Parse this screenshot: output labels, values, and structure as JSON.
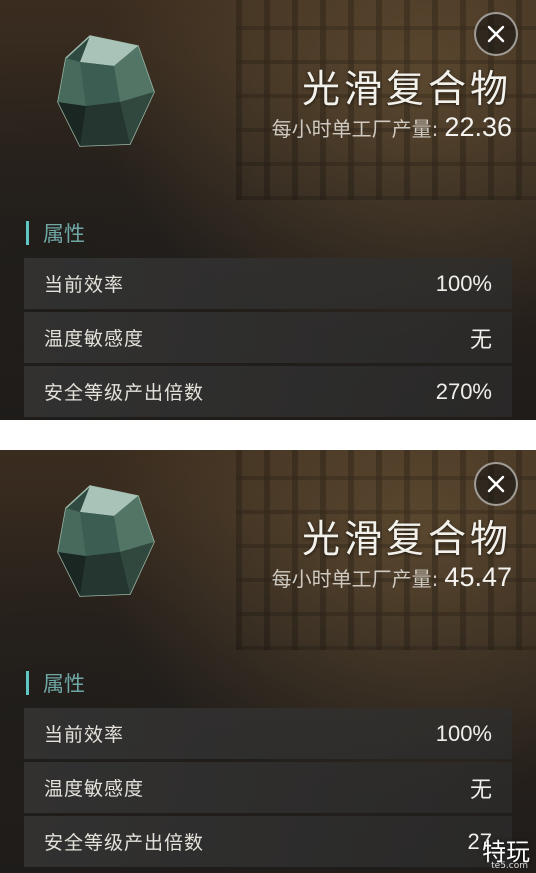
{
  "panels": [
    {
      "title": "光滑复合物",
      "rate_label": "每小时单工厂产量:",
      "rate_value": "22.36",
      "section_label": "属性",
      "rows": [
        {
          "label": "当前效率",
          "value": "100%"
        },
        {
          "label": "温度敏感度",
          "value": "无"
        },
        {
          "label": "安全等级产出倍数",
          "value": "270%"
        }
      ]
    },
    {
      "title": "光滑复合物",
      "rate_label": "每小时单工厂产量:",
      "rate_value": "45.47",
      "section_label": "属性",
      "rows": [
        {
          "label": "当前效率",
          "value": "100%"
        },
        {
          "label": "温度敏感度",
          "value": "无"
        },
        {
          "label": "安全等级产出倍数",
          "value": "27"
        }
      ]
    }
  ],
  "watermark": {
    "text": "特玩",
    "sub": "te5.com"
  },
  "icons": {
    "close": "close-icon",
    "gem": "crystal-icon"
  },
  "colors": {
    "accent": "#5ec6c4",
    "section_text": "#6fa7a5"
  }
}
